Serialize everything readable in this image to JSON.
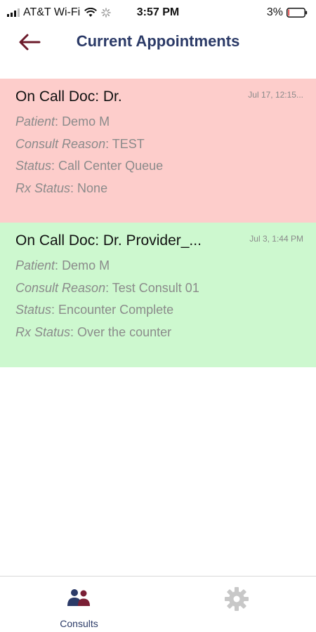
{
  "status_bar": {
    "carrier": "AT&T Wi-Fi",
    "time": "3:57 PM",
    "battery": "3%"
  },
  "header": {
    "title": "Current Appointments"
  },
  "appointments": [
    {
      "title": "On Call Doc: Dr.",
      "date": "Jul 17, 12:15...",
      "color": "#fdcdcb",
      "patient_label": "Patient",
      "patient": "Demo M",
      "reason_label": "Consult Reason",
      "reason": "TEST",
      "status_label": "Status",
      "status": "Call Center Queue",
      "rx_label": "Rx Status",
      "rx": "None"
    },
    {
      "title": "On Call Doc: Dr. Provider_...",
      "date": "Jul 3, 1:44 PM",
      "color": "#cdf8cf",
      "patient_label": "Patient",
      "patient": "Demo M",
      "reason_label": "Consult Reason",
      "reason": "Test Consult 01",
      "status_label": "Status",
      "status": "Encounter Complete",
      "rx_label": "Rx Status",
      "rx": "Over the counter"
    }
  ],
  "tabbar": {
    "consults_label": "Consults",
    "consults_icon": "people-icon",
    "settings_icon": "gear-icon",
    "active_color": "#2b3a67",
    "inactive_color": "#c8c8c8"
  }
}
